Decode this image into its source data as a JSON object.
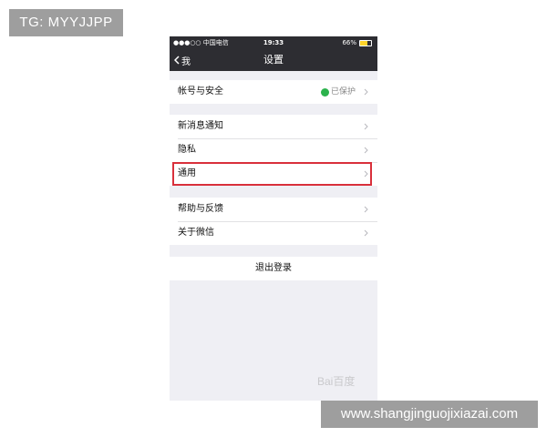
{
  "overlay": {
    "tg_label": "TG: MYYJJPP",
    "url_label": "www.shangjinguojixiazai.com",
    "watermark": "Bai百度"
  },
  "statusbar": {
    "carrier": "●●●○○ 中国电信",
    "time": "19:33",
    "battery_text": "66%",
    "battery_level": 0.66
  },
  "navbar": {
    "back_label": "我",
    "title": "设置"
  },
  "groups": {
    "account": {
      "label": "帐号与安全",
      "status": "已保护"
    },
    "notifications": [
      {
        "label": "新消息通知"
      },
      {
        "label": "隐私"
      },
      {
        "label": "通用"
      }
    ],
    "help": [
      {
        "label": "帮助与反馈"
      },
      {
        "label": "关于微信"
      }
    ]
  },
  "logout_label": "退出登录",
  "colors": {
    "navbar_bg": "#2d2d32",
    "page_bg": "#efeff4",
    "highlight_border": "#d9303b",
    "protected_green": "#2bb24c"
  }
}
